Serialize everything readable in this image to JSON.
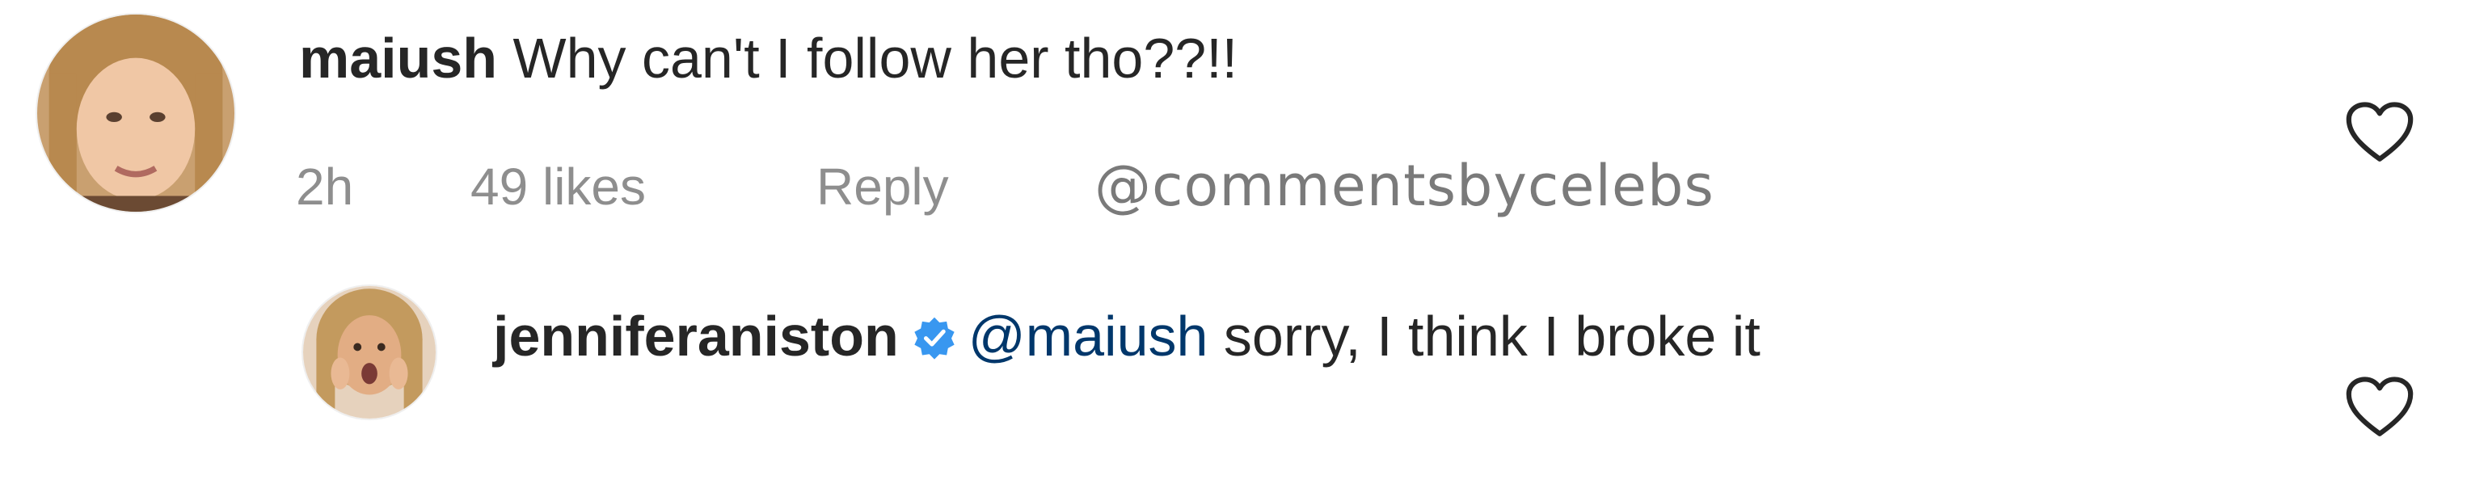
{
  "comment": {
    "username": "maiush",
    "text": "Why can't I follow her tho??!!",
    "time": "2h",
    "likes": "49 likes",
    "reply_label": "Reply",
    "watermark": "@commentsbycelebs"
  },
  "reply": {
    "username": "jenniferaniston",
    "mention": "@maiush",
    "text": " sorry, I think I broke it"
  },
  "colors": {
    "text": "#262626",
    "meta": "#8e8e8e",
    "mention": "#00376b",
    "verified": "#3897f0"
  },
  "icons": {
    "like": "heart-outline-icon",
    "verified": "verified-badge-icon"
  }
}
